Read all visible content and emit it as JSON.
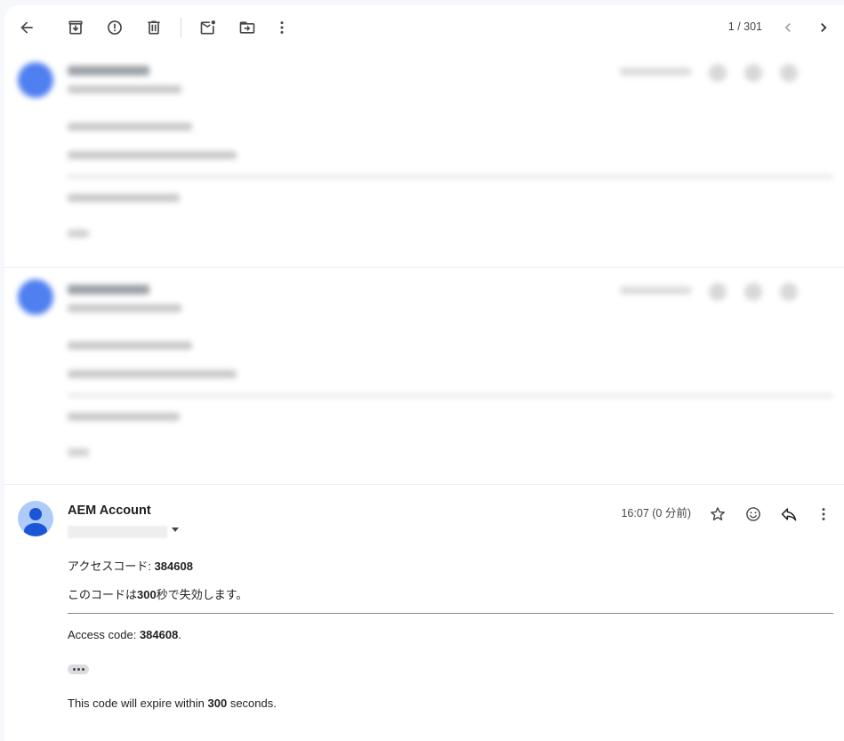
{
  "toolbar": {
    "back": "back-arrow-icon",
    "archive": "archive-icon",
    "spam": "report-spam-icon",
    "delete": "trash-icon",
    "unread": "mark-unread-icon",
    "move": "move-to-folder-icon",
    "more": "more-vert-icon",
    "pager_text": "1 / 301",
    "prev": "chevron-left-icon",
    "next": "chevron-right-icon"
  },
  "message": {
    "sender": "AEM Account",
    "time": "16:07 (0 分前)",
    "line1_prefix": "アクセスコード: ",
    "line1_code": "384608",
    "line2_prefix": "このコードは",
    "line2_num": "300",
    "line2_suffix": "秒で失効します。",
    "line3_prefix": "Access code: ",
    "line3_code": "384608",
    "line3_suffix": ".",
    "line4_prefix": "This code will expire within ",
    "line4_num": "300",
    "line4_suffix": " seconds."
  },
  "colors": {
    "accent": "#1a73e8",
    "avatar_bg": "#aecbfa",
    "avatar_fg": "#1a56d6",
    "background": "#f6f8fc"
  }
}
